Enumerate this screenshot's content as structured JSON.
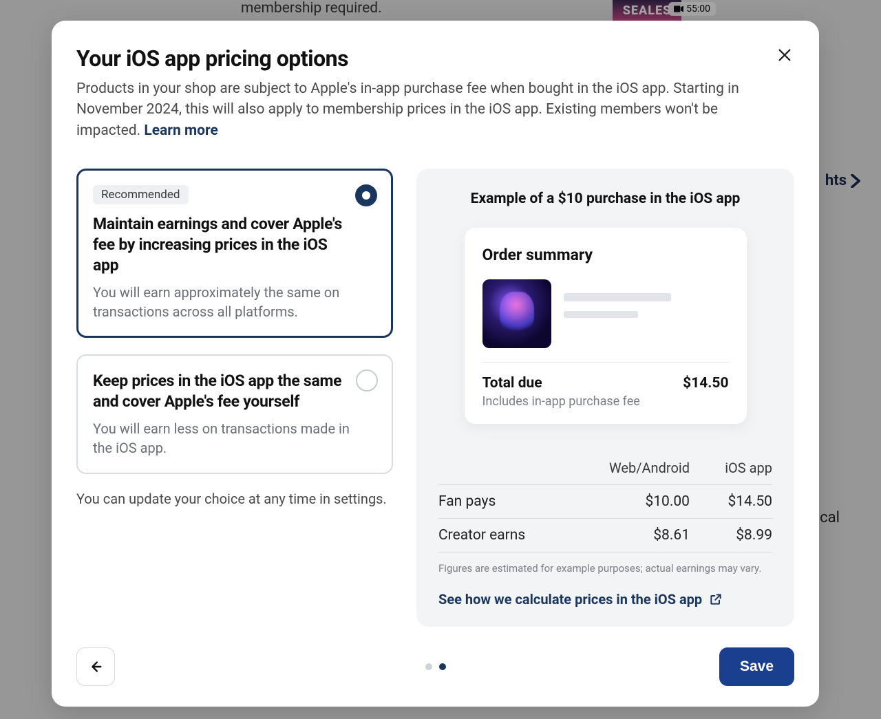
{
  "background": {
    "membership_text": "membership required.",
    "video_badge": "55:00",
    "poster_text": "SEALES",
    "side_link": "hts",
    "lower_word": "cal"
  },
  "modal": {
    "title": "Your iOS app pricing options",
    "subtitle": "Products in your shop are subject to Apple's in-app purchase fee when bought in the iOS app. Starting in November 2024, this will also apply to membership prices in the iOS app. Existing members won't be impacted. ",
    "learn_more": "Learn more",
    "options": [
      {
        "badge": "Recommended",
        "title": "Maintain earnings and cover Apple's fee by increasing prices in the iOS app",
        "desc": "You will earn approximately the same on transactions across all platforms.",
        "selected": true
      },
      {
        "title": "Keep prices in the iOS app the same and cover Apple's fee yourself",
        "desc": "You will earn less on transactions made in the iOS app.",
        "selected": false
      }
    ],
    "settings_note": "You can update your choice at any time in settings.",
    "example": {
      "heading": "Example of a $10 purchase in the iOS app",
      "order_summary_label": "Order summary",
      "total_due_label": "Total due",
      "total_due_value": "$14.50",
      "total_sub": "Includes in-app purchase fee",
      "table": {
        "col_web": "Web/Android",
        "col_ios": "iOS app",
        "rows": [
          {
            "label": "Fan pays",
            "web": "$10.00",
            "ios": "$14.50"
          },
          {
            "label": "Creator earns",
            "web": "$8.61",
            "ios": "$8.99"
          }
        ]
      },
      "disclaimer": "Figures are estimated for example purposes; actual earnings may vary.",
      "calc_link": "See how we calculate prices in the iOS app"
    },
    "footer": {
      "save": "Save"
    }
  },
  "chart_data": {
    "type": "table",
    "title": "Example of a $10 purchase in the iOS app",
    "columns": [
      "",
      "Web/Android",
      "iOS app"
    ],
    "rows": [
      [
        "Fan pays",
        10.0,
        14.5
      ],
      [
        "Creator earns",
        8.61,
        8.99
      ]
    ],
    "total_due": 14.5,
    "currency": "USD"
  }
}
